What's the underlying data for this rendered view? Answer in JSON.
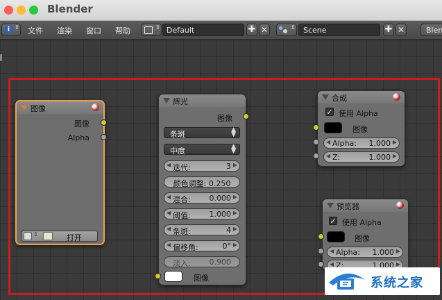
{
  "window": {
    "title": "Blender"
  },
  "colors": {
    "traffic_red": "#ff5f57",
    "traffic_yellow": "#febc2e",
    "traffic_green": "#28c840",
    "frame_red": "#c81e1e",
    "node_select": "#f0a24a",
    "socket_yellow": "#cccc2e"
  },
  "menubar": {
    "menus": [
      "文件",
      "渲染",
      "窗口",
      "帮助"
    ],
    "layout": "Default",
    "scene": "Scene",
    "engine": "Blen"
  },
  "image_node": {
    "title": "图像",
    "out_image": "图像",
    "out_alpha": "Alpha",
    "open_label": "打开"
  },
  "glare_node": {
    "title": "辉光",
    "out_image": "图像",
    "type": "条斑",
    "quality": "中度",
    "iterations": {
      "label": "迭代:",
      "value": "3"
    },
    "color_mod": {
      "label": "颜色调整:",
      "value": "0.250"
    },
    "mix": {
      "label": "混合:",
      "value": "0.000"
    },
    "threshold": {
      "label": "阈值:",
      "value": "1.000"
    },
    "streaks": {
      "label": "条斑:",
      "value": "4"
    },
    "angle": {
      "label": "偏移角:",
      "value": "0°"
    },
    "fade": {
      "label": "淡入:",
      "value": "0.900"
    },
    "in_image": "图像"
  },
  "composite_node": {
    "title": "合成",
    "use_alpha": "使用 Alpha",
    "image": "图像",
    "alpha": {
      "label": "Alpha:",
      "value": "1.000"
    },
    "z": {
      "label": "Z:",
      "value": "1.000"
    }
  },
  "viewer_node": {
    "title": "预览器",
    "use_alpha": "使用 Alpha",
    "image": "图像",
    "alpha": {
      "label": "Alpha:",
      "value": "1.000"
    },
    "z": {
      "label": "Z:",
      "value": "1.000"
    }
  },
  "watermark": {
    "text": "系统之家"
  }
}
